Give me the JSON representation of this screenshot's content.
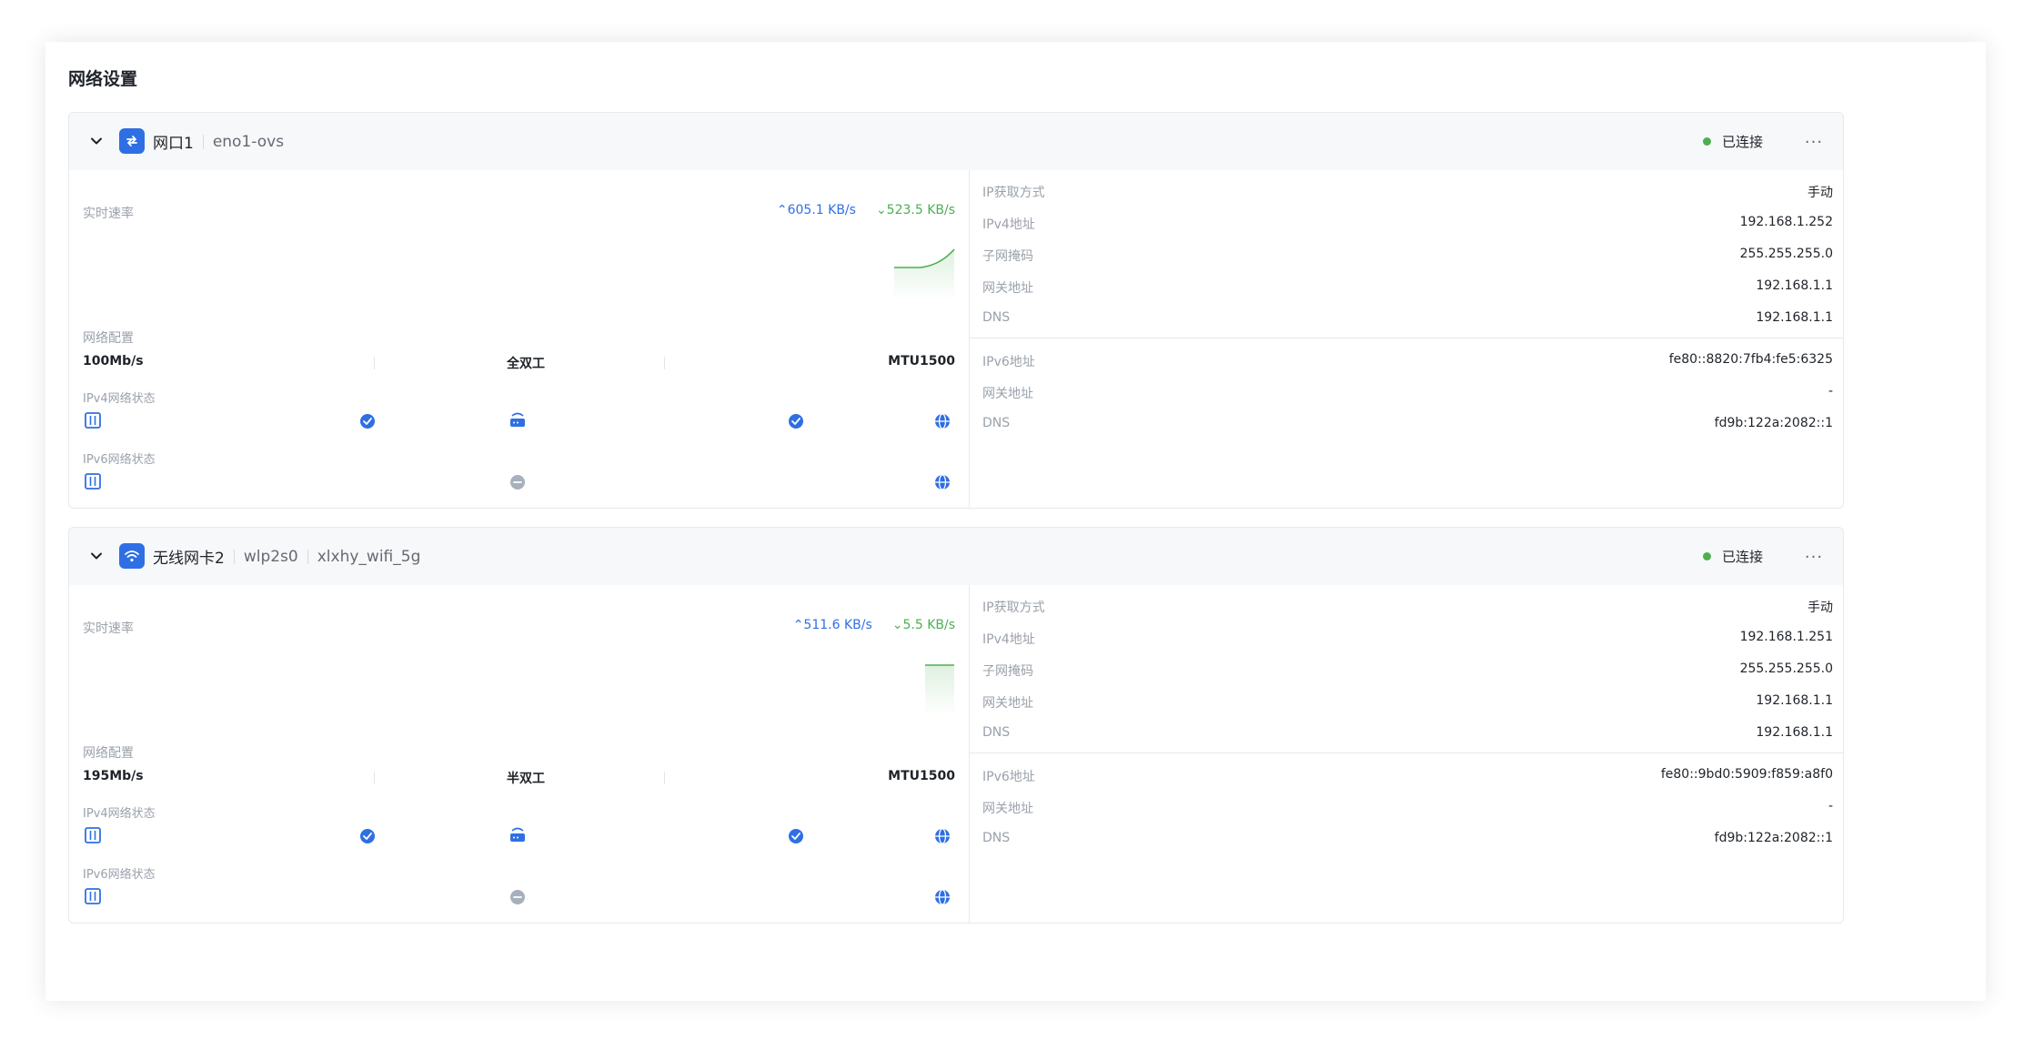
{
  "page": {
    "title": "网络设置"
  },
  "labels": {
    "realtime_rate": "实时速率",
    "net_config": "网络配置",
    "ipv4_status": "IPv4网络状态",
    "ipv6_status": "IPv6网络状态",
    "ip_method": "IP获取方式",
    "ipv4_addr": "IPv4地址",
    "subnet": "子网掩码",
    "gateway": "网关地址",
    "dns": "DNS",
    "ipv6_addr": "IPv6地址",
    "gateway6": "网关地址",
    "dns6": "DNS"
  },
  "colors": {
    "accent": "#2f6fe4",
    "success": "#4caf50",
    "idle": "#a7b0bd"
  },
  "cards": [
    {
      "name": "网口1",
      "interface": "eno1-ovs",
      "ssid": "",
      "icon": "ethernet-swap-icon",
      "status": "已连接",
      "more": "···",
      "upload": "605.1 KB/s",
      "download": "523.5 KB/s",
      "speed": "100Mb/s",
      "duplex": "全双工",
      "mtu": "MTU1500",
      "ipv4_status": "connected",
      "ipv6_status": "idle",
      "ip_method": "手动",
      "ipv4": "192.168.1.252",
      "subnet": "255.255.255.0",
      "gateway": "192.168.1.1",
      "dns": "192.168.1.1",
      "ipv6": "fe80::8820:7fb4:fe5:6325",
      "gateway6": "-",
      "dns6": "fd9b:122a:2082::1"
    },
    {
      "name": "无线网卡2",
      "interface": "wlp2s0",
      "ssid": "xlxhy_wifi_5g",
      "icon": "wifi-icon",
      "status": "已连接",
      "more": "···",
      "upload": "511.6 KB/s",
      "download": "5.5 KB/s",
      "speed": "195Mb/s",
      "duplex": "半双工",
      "mtu": "MTU1500",
      "ipv4_status": "connected",
      "ipv6_status": "idle",
      "ip_method": "手动",
      "ipv4": "192.168.1.251",
      "subnet": "255.255.255.0",
      "gateway": "192.168.1.1",
      "dns": "192.168.1.1",
      "ipv6": "fe80::9bd0:5909:f859:a8f0",
      "gateway6": "-",
      "dns6": "fd9b:122a:2082::1"
    }
  ]
}
